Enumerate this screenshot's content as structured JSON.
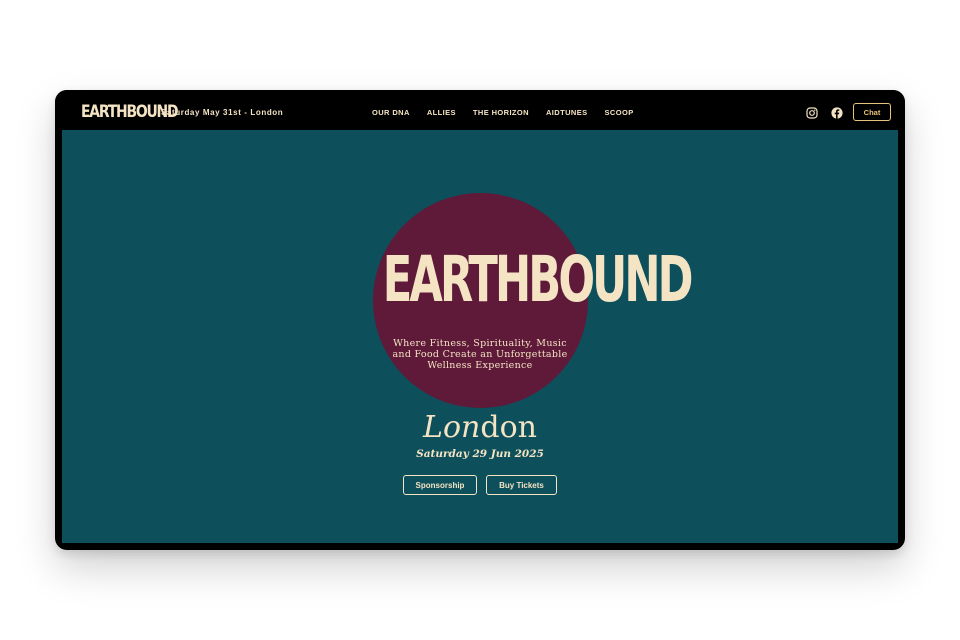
{
  "brand": {
    "logo_text": "EARTHBOUND",
    "header_date": "Saturday May 31st - London"
  },
  "nav": {
    "items": [
      "OUR DNA",
      "ALLIES",
      "THE HORIZON",
      "AIDTUNES",
      "SCOOP"
    ]
  },
  "header_actions": {
    "instagram_icon": "instagram-icon",
    "facebook_icon": "facebook-icon",
    "chat_label": "Chat"
  },
  "hero": {
    "title": "EARTHBOUND",
    "tagline_lines": [
      "Where Fitness, Spirituality, Music",
      "and Food Create an Unforgettable",
      "Wellness Experience"
    ],
    "city": "London",
    "date": "Saturday 29 Jun 2025",
    "buttons": {
      "sponsorship": "Sponsorship",
      "tickets": "Buy Tickets"
    }
  },
  "colors": {
    "background": "#0d4f5b",
    "circle": "#5f1a3a",
    "text": "#f4e4c4",
    "chat_border": "#e7c27a",
    "topbar": "#000000"
  }
}
